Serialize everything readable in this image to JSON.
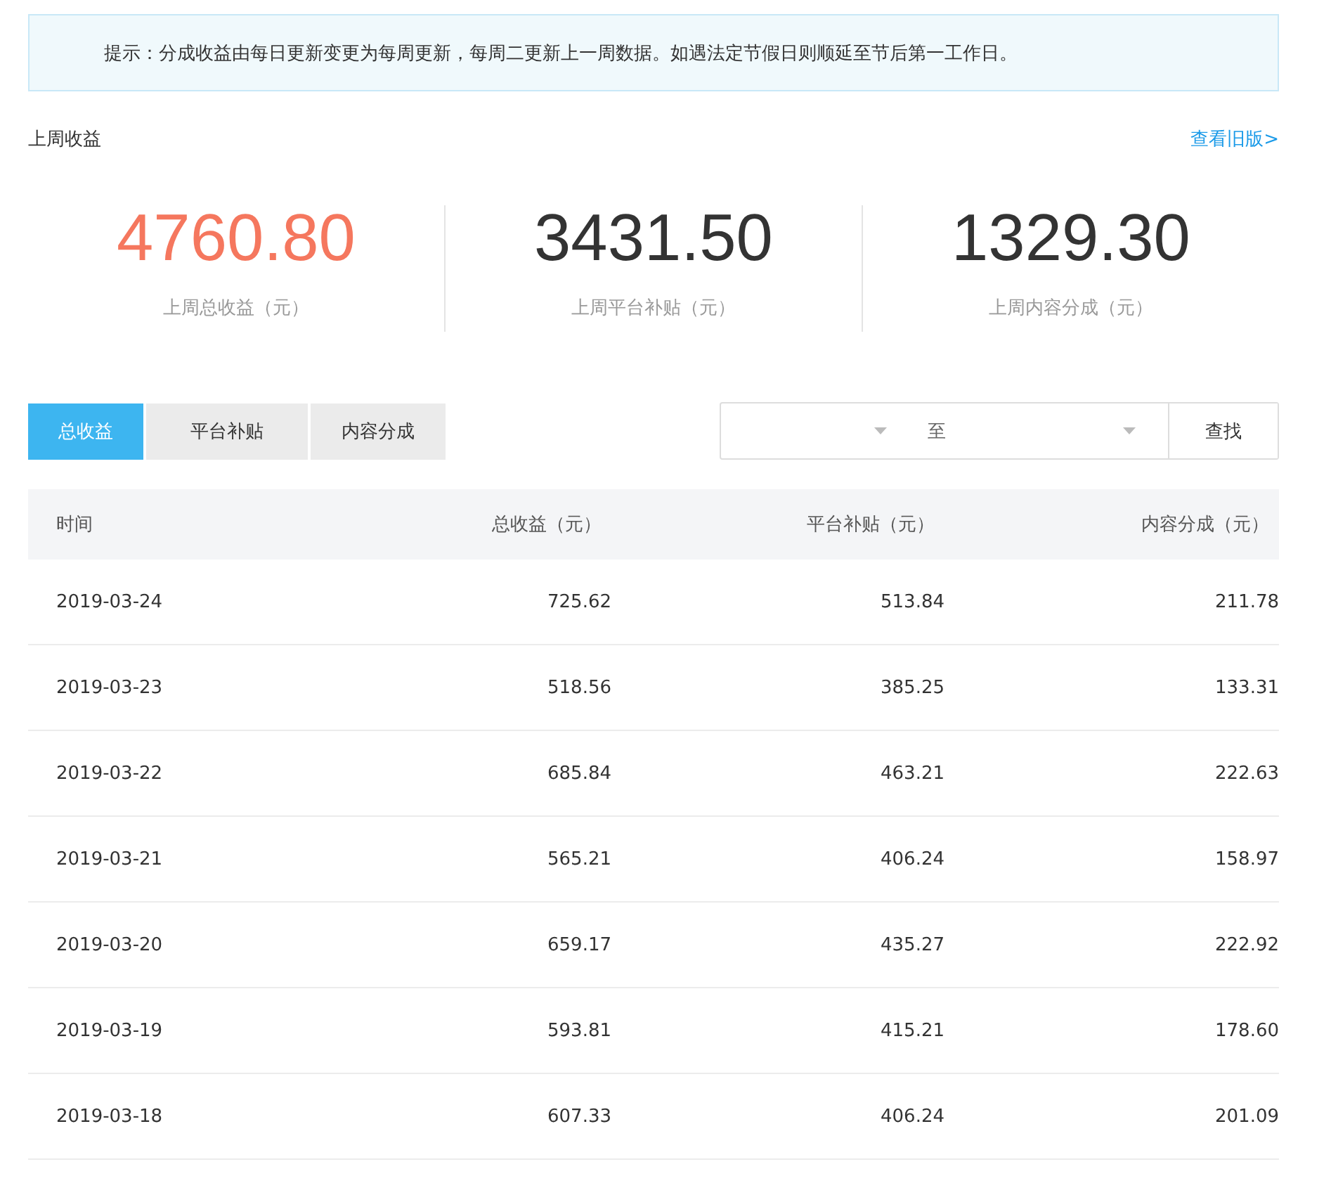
{
  "notice": "提示：分成收益由每日更新变更为每周更新，每周二更新上一周数据。如遇法定节假日则顺延至节后第一工作日。",
  "section_title": "上周收益",
  "old_version_link": "查看旧版>",
  "stats": [
    {
      "value": "4760.80",
      "label": "上周总收益（元）",
      "color": "#f5775e"
    },
    {
      "value": "3431.50",
      "label": "上周平台补贴（元）",
      "color": "#333333"
    },
    {
      "value": "1329.30",
      "label": "上周内容分成（元）",
      "color": "#333333"
    }
  ],
  "tabs": [
    {
      "label": "总收益",
      "selected": true
    },
    {
      "label": "平台补贴",
      "selected": false
    },
    {
      "label": "内容分成",
      "selected": false
    }
  ],
  "date_range": {
    "separator": "至"
  },
  "search_button": "查找",
  "table": {
    "columns": [
      "时间",
      "总收益（元）",
      "平台补贴（元）",
      "内容分成（元）"
    ],
    "rows": [
      [
        "2019-03-24",
        "725.62",
        "513.84",
        "211.78"
      ],
      [
        "2019-03-23",
        "518.56",
        "385.25",
        "133.31"
      ],
      [
        "2019-03-22",
        "685.84",
        "463.21",
        "222.63"
      ],
      [
        "2019-03-21",
        "565.21",
        "406.24",
        "158.97"
      ],
      [
        "2019-03-20",
        "659.17",
        "435.27",
        "222.92"
      ],
      [
        "2019-03-19",
        "593.81",
        "415.21",
        "178.60"
      ],
      [
        "2019-03-18",
        "607.33",
        "406.24",
        "201.09"
      ]
    ]
  }
}
